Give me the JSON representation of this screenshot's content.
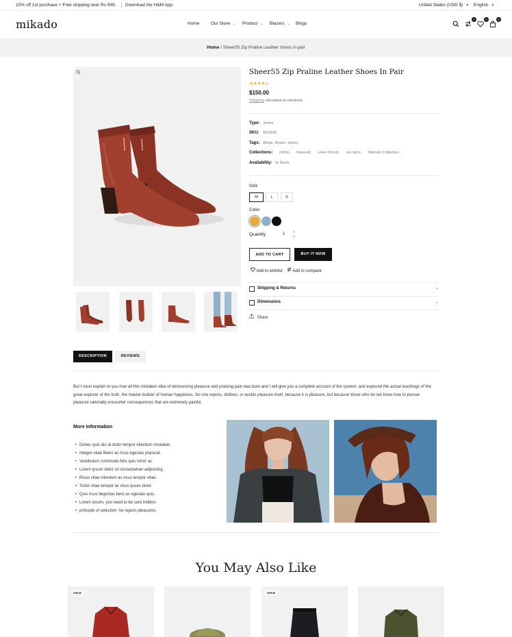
{
  "topbar": {
    "promo": "10% off 1st purchase + Free shipping over Rs 999.",
    "app": "Download the H&M App",
    "currency": "United States (USD $)",
    "language": "English"
  },
  "header": {
    "logo": "mikado",
    "nav": [
      "Home",
      "Our Store",
      "Product",
      "Blazers",
      "Blogs"
    ],
    "compare_count": "0",
    "wishlist_count": "0",
    "cart_count": "0"
  },
  "breadcrumb": {
    "home": "Home",
    "separator": "/",
    "current": "Sheer55 Zip Praline Leather shoes in pair"
  },
  "product": {
    "title": "Sheer55 Zip Praline Leather Shoes In Pair",
    "rating": 4,
    "rating_max": 5,
    "price": "$150.00",
    "shipping_link": "Shipping",
    "shipping_text": "calculated at checkout.",
    "type_label": "Type:",
    "type_value": "shoes",
    "sku_label": "SKU:",
    "sku_value": "SKU036",
    "tags_label": "Tags:",
    "tags_value": "Beige, Brown, shoes,",
    "collections_label": "Collections:",
    "collections": [
      "cloths ,",
      "featured ,",
      "Linen Shorts ,",
      "our store ,",
      "Women Collection ,"
    ],
    "availability_label": "Availability:",
    "availability_value": "In Stock",
    "size_label": "Size",
    "sizes": [
      "M",
      "L",
      "S"
    ],
    "color_label": "Color",
    "colors": [
      "#e9a63a",
      "#8fb1c8",
      "#111111"
    ],
    "quantity_label": "Quantity",
    "quantity": "1",
    "add_to_cart": "ADD TO CART",
    "buy_now": "BUY IT NOW",
    "wishlist": "Add to wishlist",
    "compare": "Add to compare",
    "accordion": [
      "Shipping & Returns",
      "Dimensions"
    ],
    "share": "Share"
  },
  "tabs": {
    "description": "DESCRIPTION",
    "reviews": "REVIEWS"
  },
  "description": {
    "text": "But I must explain to you how all this mistaken idea of denouncing pleasure and praising pain was born and I will give you a complete account of the system, and expound the actual teachings of the great explorer of the truth, the master-builder of human happiness. No one rejects, dislikes, or avoids pleasure itself, because it is pleasure, but because those who do not know how to pursue pleasure rationally encounter consequences that are extremely painful.",
    "more_title": "More Information",
    "bullets": [
      "Donec quis dui at dolor tempor interdum mistaken.",
      "Integer vitae libero ac risus egestas placerat.",
      "Vestibulum commodo felis quis tortor ac.",
      "Lorem ipsum dolor sit consectetuer adipiscing .",
      "Risus vitae interdum ac risus tempor vitae.",
      "Tortor vitae tempor ac risus ipsum dolor.",
      "Quis risus liegestas bero ac egestas quis.",
      "Lorem Ipsum, you need to be sure hidden.",
      "principle of selection: he rejects pleasures."
    ]
  },
  "also_like": {
    "title": "You May Also Like",
    "sale_badge": "SALE"
  }
}
